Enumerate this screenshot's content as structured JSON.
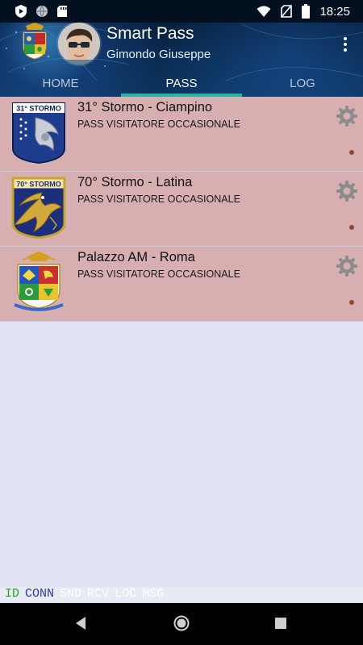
{
  "status_bar": {
    "time": "18:25",
    "icons": [
      "shield-icon",
      "globe-icon",
      "sd-card-icon",
      "wifi-icon",
      "no-sim-icon",
      "battery-icon"
    ]
  },
  "header": {
    "app_title": "Smart Pass",
    "user_name": "Gimondo Giuseppe"
  },
  "tabs": [
    {
      "label": "HOME",
      "active": false
    },
    {
      "label": "PASS",
      "active": true
    },
    {
      "label": "LOG",
      "active": false
    }
  ],
  "passes": [
    {
      "title": "31° Stormo - Ciampino",
      "subtitle": "PASS VISITATORE OCCASIONALE",
      "badge_text": "31° STORMO"
    },
    {
      "title": "70° Stormo - Latina",
      "subtitle": "PASS VISITATORE OCCASIONALE",
      "badge_text": "70° STORMO"
    },
    {
      "title": "Palazzo AM - Roma",
      "subtitle": "PASS VISITATORE OCCASIONALE",
      "badge_text": ""
    }
  ],
  "debug_bar": [
    {
      "label": "ID",
      "color": "#2aa12a"
    },
    {
      "label": "CONN",
      "color": "#2b3ea8"
    },
    {
      "label": "SND",
      "color": "#ffffff"
    },
    {
      "label": "RCV",
      "color": "#ffffff"
    },
    {
      "label": "LOC",
      "color": "#ffffff"
    },
    {
      "label": "MSG",
      "color": "#ffffff"
    }
  ],
  "colors": {
    "accent": "#27b3a6",
    "item_bg": "#d8afb1",
    "list_bg": "#dfe3f4",
    "header_dark": "#04172e"
  }
}
